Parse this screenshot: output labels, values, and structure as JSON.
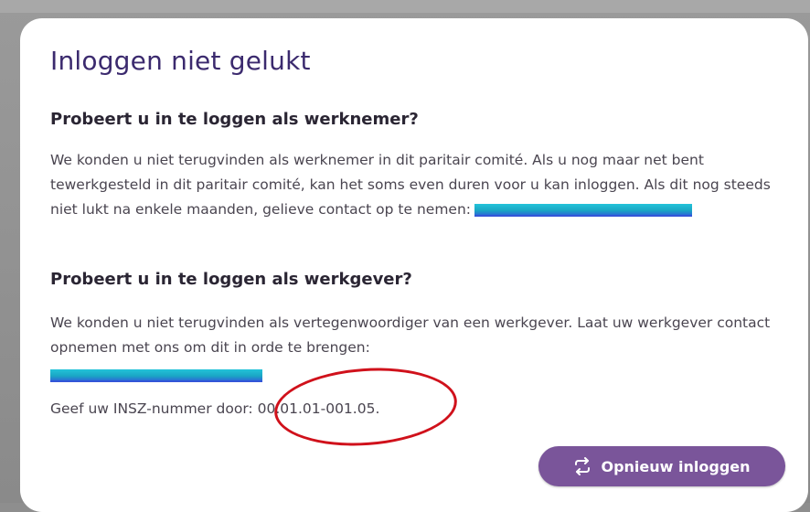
{
  "dialog": {
    "title": "Inloggen niet gelukt",
    "employee_section": {
      "heading": "Probeert u in te loggen als werknemer?",
      "text": "We konden u niet terugvinden als werknemer in dit paritair comité. Als u nog maar net bent tewerkgesteld in dit paritair comité, kan het soms even duren voor u kan inloggen. Als dit nog steeds niet lukt na enkele maanden, gelieve contact op te nemen:"
    },
    "employer_section": {
      "heading": "Probeert u in te loggen als werkgever?",
      "text": "We konden u niet terugvinden als vertegenwoordiger van een werkgever. Laat uw werkgever contact opnemen met ons om dit in orde te brengen:"
    },
    "insz": {
      "label": "Geef uw INSZ-nummer door:",
      "value": "00.01.01-001.05."
    },
    "retry_button": {
      "label": "Opnieuw inloggen",
      "icon": "refresh-icon"
    }
  },
  "colors": {
    "title": "#3b2a6e",
    "button_bg": "#7a559a",
    "annotation": "#d0111b",
    "redaction": "#23c3d9"
  }
}
